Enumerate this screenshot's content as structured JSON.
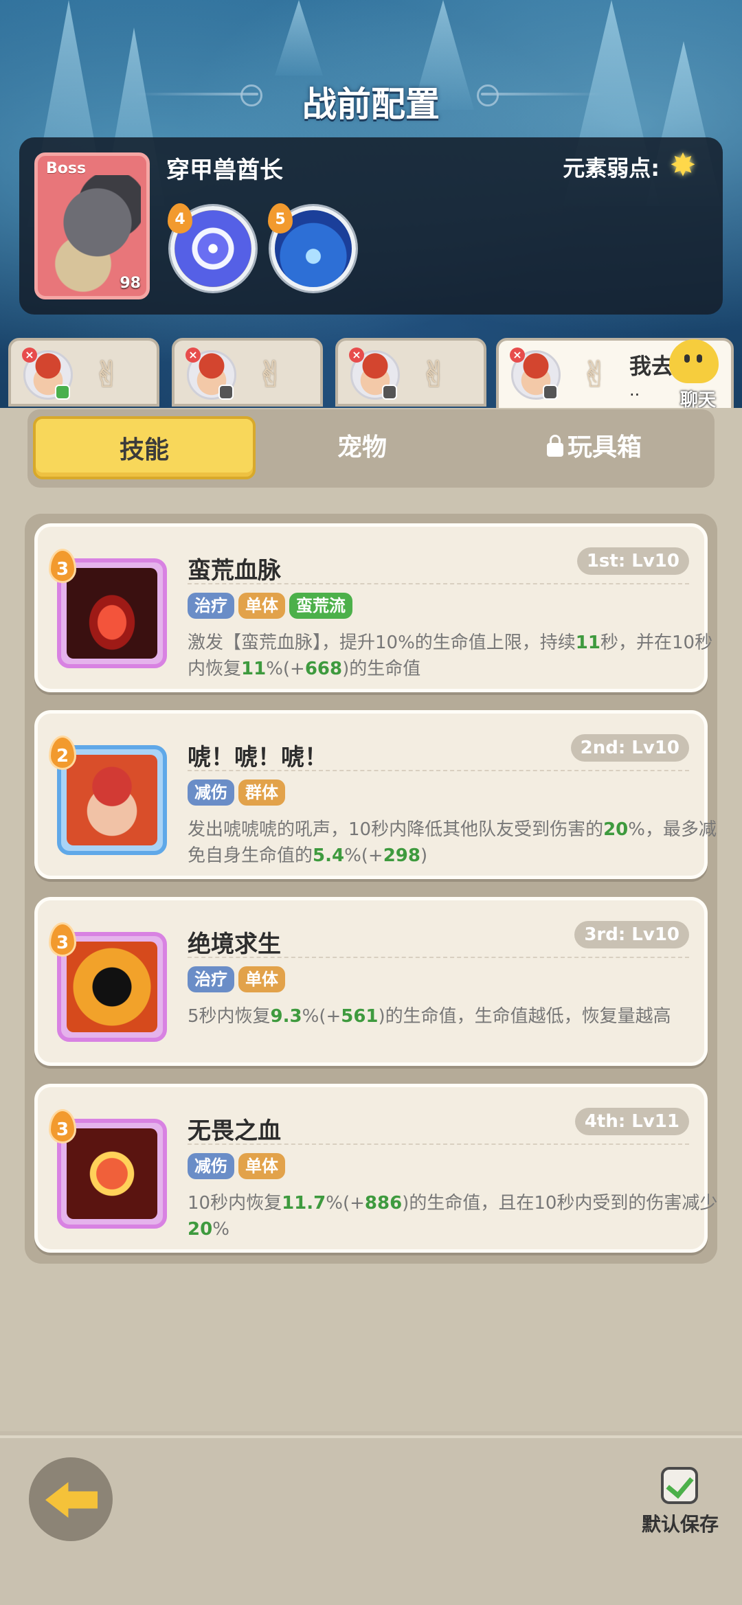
{
  "page_title": "战前配置",
  "boss": {
    "tag": "Boss",
    "level": "98",
    "name": "穿甲兽酋长",
    "weakness_label": "元素弱点:",
    "weakness_icon": "star-burst-icon",
    "orbs": [
      {
        "badge": "4",
        "icon": "wind-swirl-orb-icon"
      },
      {
        "badge": "5",
        "icon": "water-burst-orb-icon"
      }
    ]
  },
  "hero_tabs": [
    {
      "text": ""
    },
    {
      "text": ""
    },
    {
      "text": ""
    },
    {
      "text": "我去洗",
      "sub": ".."
    }
  ],
  "chat": {
    "label": "聊天"
  },
  "tabs": {
    "skill": "技能",
    "pet": "宠物",
    "toy": "玩具箱"
  },
  "skills": [
    {
      "level": "3",
      "name": "蛮荒血脉",
      "rank": "1st: Lv10",
      "tags": [
        {
          "text": "治疗",
          "color": "#6a8dc7"
        },
        {
          "text": "单体",
          "color": "#e2a24a"
        },
        {
          "text": "蛮荒流",
          "color": "#4cb04a"
        }
      ],
      "desc_parts": [
        "激发【蛮荒血脉】，提升10%的生命值上限，持续",
        "11",
        "秒，并在10秒内恢复",
        "11",
        "%(+",
        "668",
        ")的生命值"
      ]
    },
    {
      "level": "2",
      "name": "唬！唬！唬！",
      "rank": "2nd: Lv10",
      "tags": [
        {
          "text": "减伤",
          "color": "#6a8dc7"
        },
        {
          "text": "群体",
          "color": "#e2a24a"
        }
      ],
      "desc_parts": [
        "发出唬唬唬的吼声，10秒内降低其他队友受到伤害的",
        "20",
        "%，最多减免自身生命值的",
        "5.4",
        "%(+",
        "298",
        ")"
      ]
    },
    {
      "level": "3",
      "name": "绝境求生",
      "rank": "3rd: Lv10",
      "tags": [
        {
          "text": "治疗",
          "color": "#6a8dc7"
        },
        {
          "text": "单体",
          "color": "#e2a24a"
        }
      ],
      "desc_parts": [
        "5秒内恢复",
        "9.3",
        "%(+",
        "561",
        ")的生命值，生命值越低，恢复量越高"
      ]
    },
    {
      "level": "3",
      "name": "无畏之血",
      "rank": "4th: Lv11",
      "tags": [
        {
          "text": "减伤",
          "color": "#6a8dc7"
        },
        {
          "text": "单体",
          "color": "#e2a24a"
        }
      ],
      "desc_parts": [
        "10秒内恢复",
        "11.7",
        "%(+",
        "886",
        ")的生命值，且在10秒内受到的伤害减少",
        "20",
        "%"
      ]
    }
  ],
  "bottom": {
    "save_label": "默认保存",
    "back_icon": "back-arrow-icon",
    "save_icon": "checkbox-checked-icon"
  }
}
